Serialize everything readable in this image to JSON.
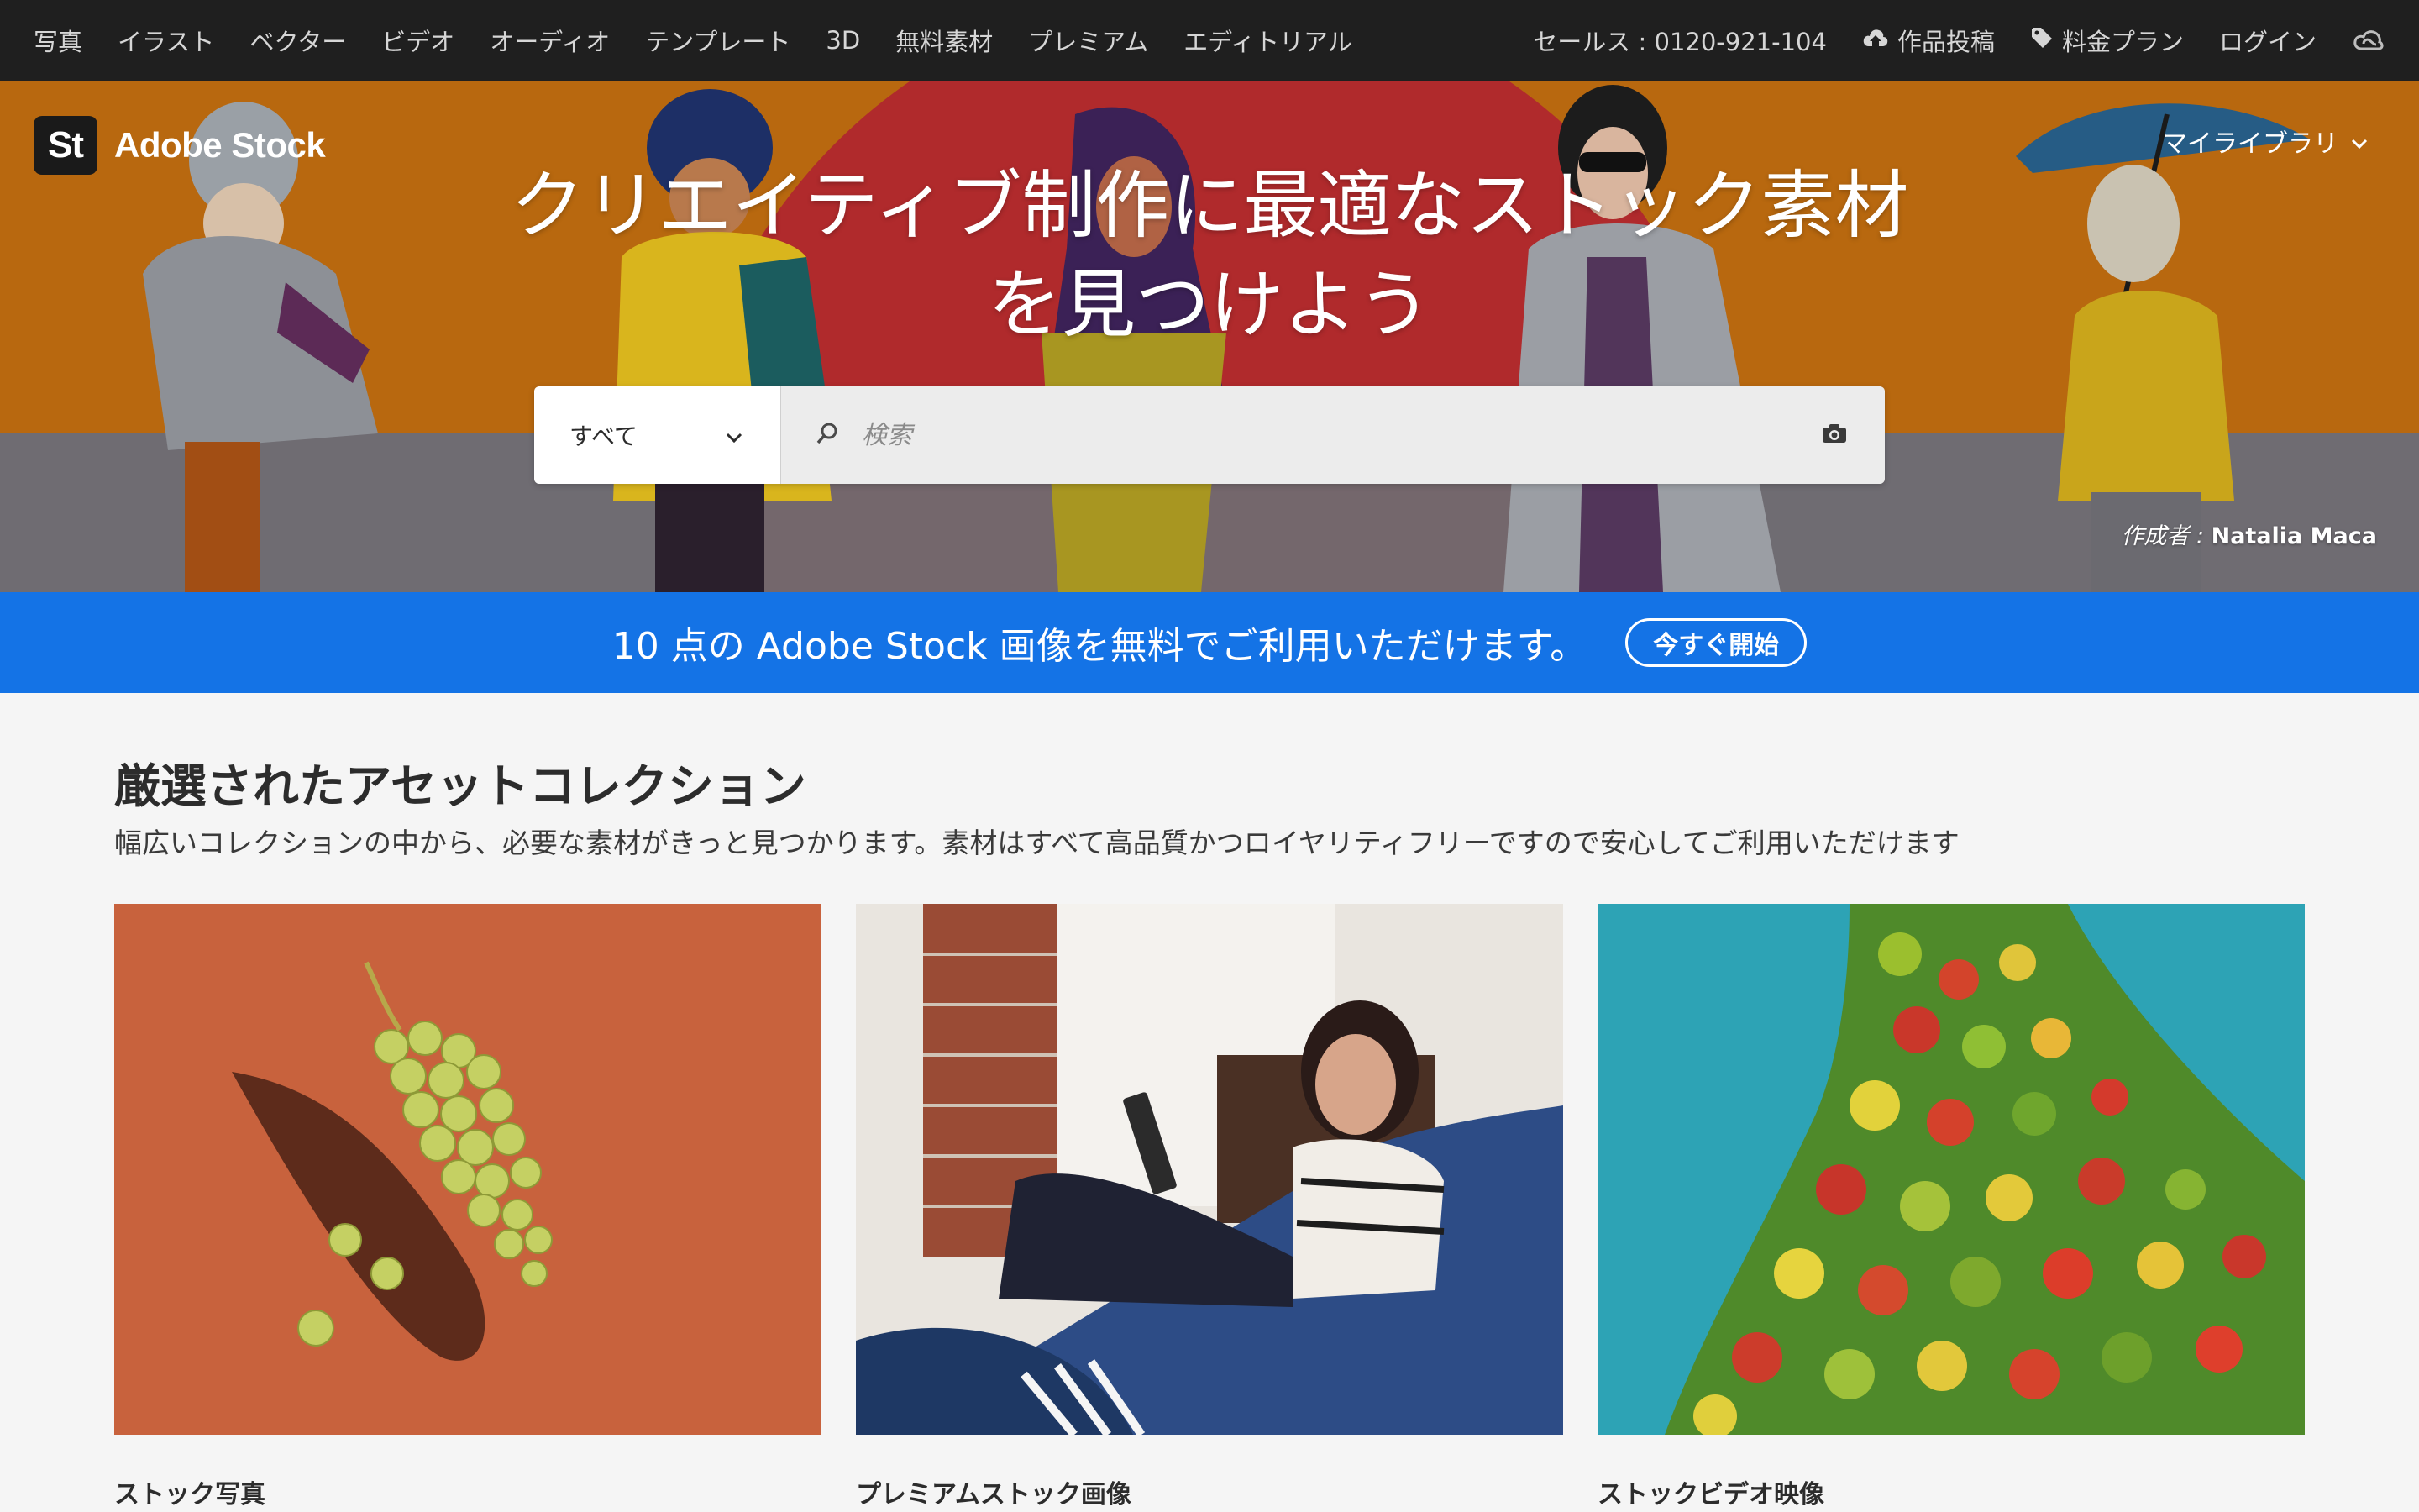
{
  "nav": {
    "left": [
      "写真",
      "イラスト",
      "ベクター",
      "ビデオ",
      "オーディオ",
      "テンプレート",
      "3D",
      "無料素材",
      "プレミアム",
      "エディトリアル"
    ],
    "sales": "セールス : 0120-921-104",
    "upload": "作品投稿",
    "pricing": "料金プラン",
    "login": "ログイン"
  },
  "brand": {
    "badge": "St",
    "name": "Adobe Stock"
  },
  "mylibrary": "マイライブラリ",
  "hero": {
    "title_line1": "クリエイティブ制作に最適なストック素材",
    "title_line2": "を見つけよう",
    "credit_prefix": "作成者 :",
    "credit_name": "Natalia Maca"
  },
  "search": {
    "category": "すべて",
    "placeholder": "検索"
  },
  "promo": {
    "text": "10 点の Adobe Stock 画像を無料でご利用いただけます。",
    "button": "今すぐ開始"
  },
  "collections": {
    "title": "厳選されたアセットコレクション",
    "subtitle": "幅広いコレクションの中から、必要な素材がきっと見つかります。素材はすべて高品質かつロイヤリティフリーですので安心してご利用いただけます",
    "cards": [
      {
        "label": "ストック写真"
      },
      {
        "label": "プレミアムストック画像"
      },
      {
        "label": "ストックビデオ映像"
      }
    ]
  },
  "colors": {
    "nav_bg": "#1f1f1f",
    "promo_bg": "#1473e6",
    "hero_orange": "#b8680f",
    "hero_red": "#b02a2c",
    "page_bg": "#f5f5f5"
  },
  "icons": [
    "cloud-upload-icon",
    "tag-icon",
    "creative-cloud-icon",
    "chevron-down-icon",
    "search-icon",
    "camera-icon"
  ]
}
